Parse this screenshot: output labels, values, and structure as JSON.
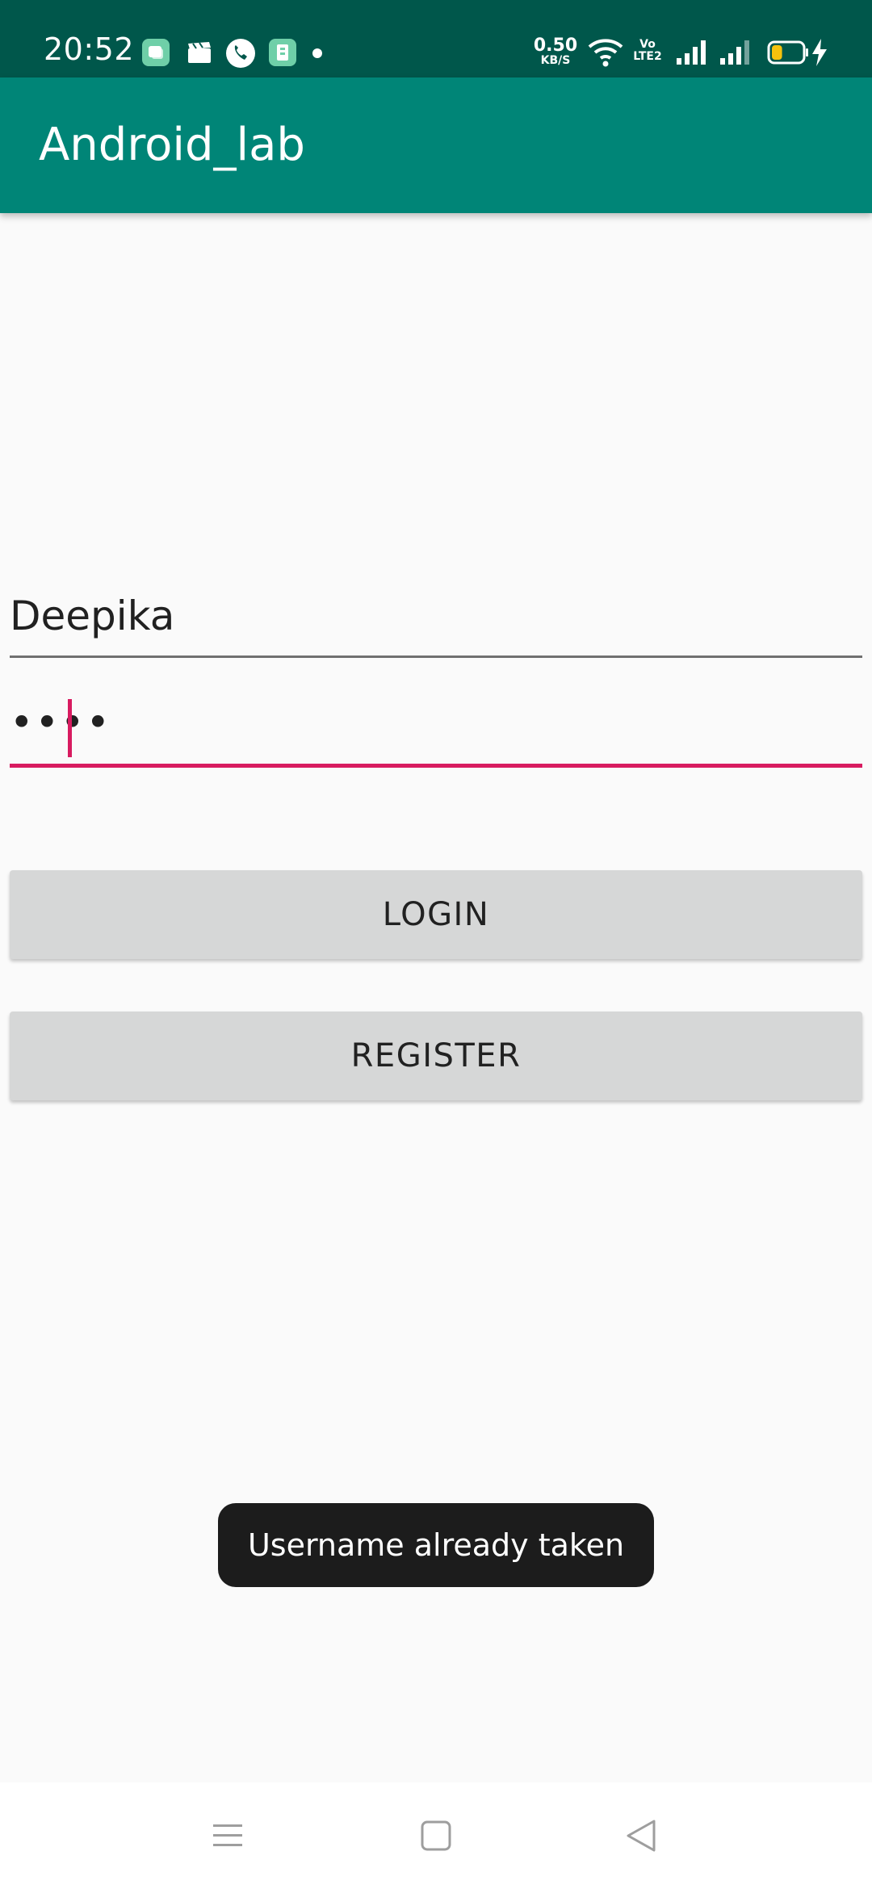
{
  "status_bar": {
    "time": "20:52",
    "network_speed_value": "0.50",
    "network_speed_unit": "KB/S",
    "volte_top": "Vo",
    "volte_bottom": "LTE2",
    "battery_level": 0.35,
    "charging": true,
    "colors": {
      "background": "#00574b",
      "notif_icon_bg": "#6fcfa8"
    },
    "notification_icons": [
      "app-icon",
      "clapperboard-icon",
      "phone-icon",
      "clipboard-icon",
      "dot-icon"
    ]
  },
  "app_bar": {
    "title": "Android_lab",
    "color": "#008577"
  },
  "form": {
    "username_value": "Deepika",
    "password_value": "••••",
    "accent_color": "#d81b60"
  },
  "buttons": {
    "login_label": "LOGIN",
    "register_label": "REGISTER"
  },
  "toast": {
    "message": "Username already taken"
  },
  "nav_bar": {
    "icons": [
      "menu-icon",
      "home-square-icon",
      "back-triangle-icon"
    ]
  }
}
